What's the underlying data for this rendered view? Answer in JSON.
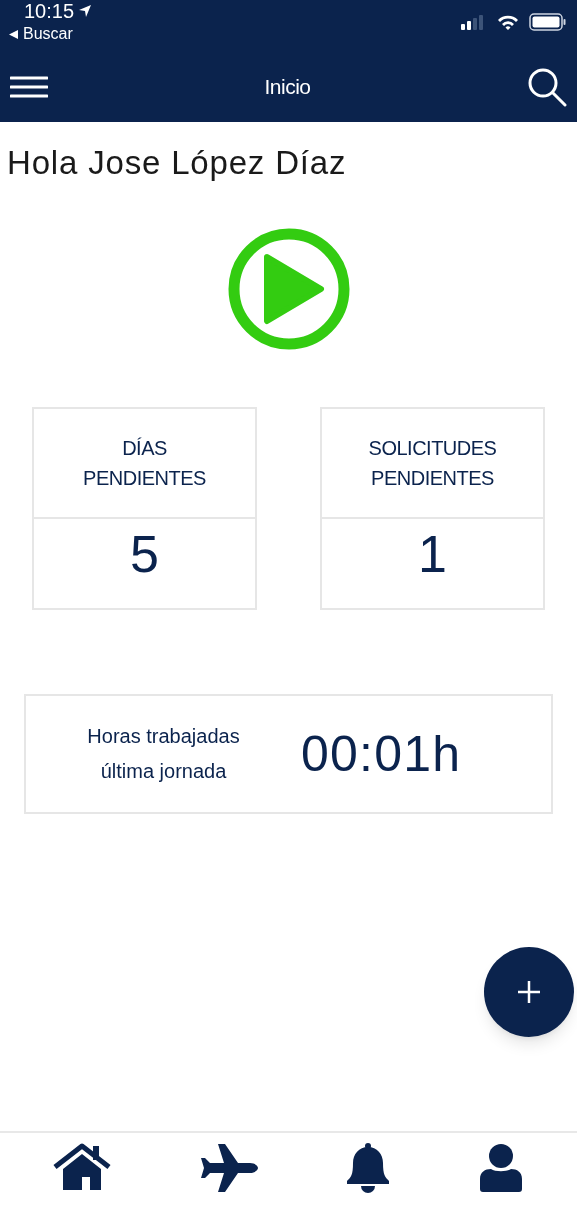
{
  "status_bar": {
    "time": "10:15",
    "back_label": "Buscar"
  },
  "header": {
    "title": "Inicio"
  },
  "greeting": "Hola Jose López Díaz",
  "stats": [
    {
      "label": "DÍAS PENDIENTES",
      "value": "5"
    },
    {
      "label": "SOLICITUDES PENDIENTES",
      "value": "1"
    }
  ],
  "hours": {
    "label": "Horas trabajadas última jornada",
    "value": "00:01h"
  }
}
